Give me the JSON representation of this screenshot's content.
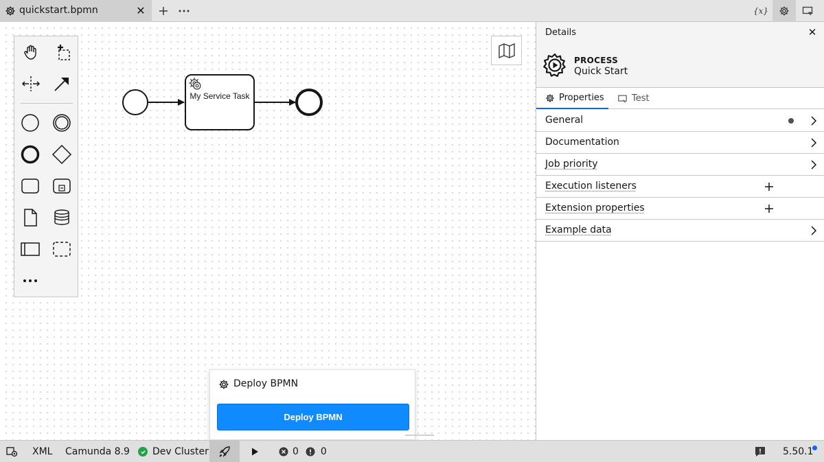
{
  "tab": {
    "title": "quickstart.bpmn",
    "icon": "gear-icon",
    "close_icon": "close-icon"
  },
  "toolbar": {
    "new_tab_icon": "plus-icon",
    "more_icon": "overflow-menu-icon",
    "right_icons": [
      "variables-icon",
      "settings-icon",
      "test-panel-icon"
    ]
  },
  "palette": {
    "tools": [
      "hand-tool-icon",
      "lasso-tool-icon",
      "space-tool-icon",
      "connect-tool-icon"
    ],
    "shapes": [
      "start-event-icon",
      "intermediate-event-icon",
      "end-event-icon",
      "gateway-icon",
      "task-icon",
      "subprocess-icon",
      "data-object-icon",
      "data-store-icon",
      "pool-icon",
      "group-icon",
      "more-icon"
    ]
  },
  "diagram": {
    "task_label": "My Service Task"
  },
  "deploy": {
    "title": "Deploy BPMN",
    "button_label": "Deploy BPMN"
  },
  "panel": {
    "header": "Details",
    "element_type": "PROCESS",
    "element_name": "Quick Start",
    "tabs": [
      {
        "label": "Properties",
        "active": true
      },
      {
        "label": "Test",
        "active": false
      }
    ],
    "groups": [
      {
        "label": "General",
        "control": "chevron",
        "dot": true
      },
      {
        "label": "Documentation",
        "control": "chevron",
        "dot": false
      },
      {
        "label": "Job priority",
        "control": "chevron",
        "dot": false
      },
      {
        "label": "Execution listeners",
        "control": "plus",
        "dot": false
      },
      {
        "label": "Extension properties",
        "control": "plus",
        "dot": false
      },
      {
        "label": "Example data",
        "control": "chevron",
        "dot": false
      }
    ]
  },
  "statusbar": {
    "xml_label": "XML",
    "engine_label": "Camunda 8.9",
    "cluster_label": "Dev Cluster",
    "errors": "0",
    "warnings": "0",
    "version": "5.50.1",
    "accent": "#0f62fe",
    "ok_color": "#24a148"
  }
}
